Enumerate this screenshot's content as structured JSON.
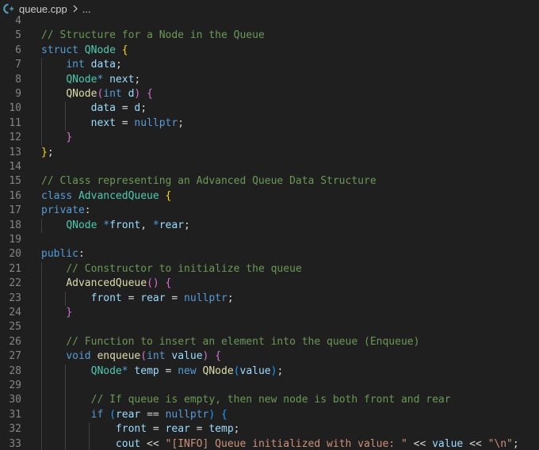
{
  "breadcrumb": {
    "file_icon": "cpp-file-icon",
    "file_name": "queue.cpp",
    "separator_icon": "chevron-right-icon",
    "ellipsis": "..."
  },
  "colors": {
    "background": "#1f1f1f",
    "line_number": "#858585",
    "comment": "#6a9955",
    "keyword": "#569cd6",
    "type": "#4ec9b0",
    "function": "#dcdcaa",
    "variable": "#9cdcfe",
    "string": "#ce9178",
    "brace_level1": "#ffd700",
    "brace_level2": "#da70d6"
  },
  "editor": {
    "lines": [
      {
        "n": "4",
        "tokens": []
      },
      {
        "n": "5",
        "tokens": [
          [
            "comment",
            "// Structure for a Node in the Queue"
          ]
        ]
      },
      {
        "n": "6",
        "tokens": [
          [
            "keyword",
            "struct"
          ],
          [
            "plain",
            " "
          ],
          [
            "type",
            "QNode"
          ],
          [
            "plain",
            " "
          ],
          [
            "brace1",
            "{"
          ]
        ]
      },
      {
        "n": "7",
        "tokens": [
          [
            "plain",
            "    "
          ],
          [
            "keyword",
            "int"
          ],
          [
            "plain",
            " "
          ],
          [
            "var",
            "data"
          ],
          [
            "plain",
            ";"
          ]
        ]
      },
      {
        "n": "8",
        "tokens": [
          [
            "plain",
            "    "
          ],
          [
            "type",
            "QNode"
          ],
          [
            "keyword",
            "*"
          ],
          [
            "plain",
            " "
          ],
          [
            "var",
            "next"
          ],
          [
            "plain",
            ";"
          ]
        ]
      },
      {
        "n": "9",
        "tokens": [
          [
            "plain",
            "    "
          ],
          [
            "func",
            "QNode"
          ],
          [
            "brace2",
            "("
          ],
          [
            "keyword",
            "int"
          ],
          [
            "plain",
            " "
          ],
          [
            "var",
            "d"
          ],
          [
            "brace2",
            ")"
          ],
          [
            "plain",
            " "
          ],
          [
            "brace2",
            "{"
          ]
        ]
      },
      {
        "n": "10",
        "tokens": [
          [
            "plain",
            "        "
          ],
          [
            "var",
            "data"
          ],
          [
            "plain",
            " = "
          ],
          [
            "var",
            "d"
          ],
          [
            "plain",
            ";"
          ]
        ]
      },
      {
        "n": "11",
        "tokens": [
          [
            "plain",
            "        "
          ],
          [
            "var",
            "next"
          ],
          [
            "plain",
            " = "
          ],
          [
            "const",
            "nullptr"
          ],
          [
            "plain",
            ";"
          ]
        ]
      },
      {
        "n": "12",
        "tokens": [
          [
            "plain",
            "    "
          ],
          [
            "brace2",
            "}"
          ]
        ]
      },
      {
        "n": "13",
        "tokens": [
          [
            "brace1",
            "}"
          ],
          [
            "plain",
            ";"
          ]
        ]
      },
      {
        "n": "14",
        "tokens": []
      },
      {
        "n": "15",
        "tokens": [
          [
            "comment",
            "// Class representing an Advanced Queue Data Structure"
          ]
        ]
      },
      {
        "n": "16",
        "tokens": [
          [
            "keyword",
            "class"
          ],
          [
            "plain",
            " "
          ],
          [
            "type",
            "AdvancedQueue"
          ],
          [
            "plain",
            " "
          ],
          [
            "brace1",
            "{"
          ]
        ]
      },
      {
        "n": "17",
        "tokens": [
          [
            "keyword",
            "private"
          ],
          [
            "plain",
            ":"
          ]
        ]
      },
      {
        "n": "18",
        "tokens": [
          [
            "plain",
            "    "
          ],
          [
            "type",
            "QNode"
          ],
          [
            "plain",
            " "
          ],
          [
            "keyword",
            "*"
          ],
          [
            "var",
            "front"
          ],
          [
            "plain",
            ", "
          ],
          [
            "keyword",
            "*"
          ],
          [
            "var",
            "rear"
          ],
          [
            "plain",
            ";"
          ]
        ]
      },
      {
        "n": "19",
        "tokens": []
      },
      {
        "n": "20",
        "tokens": [
          [
            "keyword",
            "public"
          ],
          [
            "plain",
            ":"
          ]
        ]
      },
      {
        "n": "21",
        "tokens": [
          [
            "plain",
            "    "
          ],
          [
            "comment",
            "// Constructor to initialize the queue"
          ]
        ]
      },
      {
        "n": "22",
        "tokens": [
          [
            "plain",
            "    "
          ],
          [
            "func",
            "AdvancedQueue"
          ],
          [
            "brace2",
            "()"
          ],
          [
            "plain",
            " "
          ],
          [
            "brace2",
            "{"
          ]
        ]
      },
      {
        "n": "23",
        "tokens": [
          [
            "plain",
            "        "
          ],
          [
            "var",
            "front"
          ],
          [
            "plain",
            " = "
          ],
          [
            "var",
            "rear"
          ],
          [
            "plain",
            " = "
          ],
          [
            "const",
            "nullptr"
          ],
          [
            "plain",
            ";"
          ]
        ]
      },
      {
        "n": "24",
        "tokens": [
          [
            "plain",
            "    "
          ],
          [
            "brace2",
            "}"
          ]
        ]
      },
      {
        "n": "25",
        "tokens": []
      },
      {
        "n": "26",
        "tokens": [
          [
            "plain",
            "    "
          ],
          [
            "comment",
            "// Function to insert an element into the queue (Enqueue)"
          ]
        ]
      },
      {
        "n": "27",
        "tokens": [
          [
            "plain",
            "    "
          ],
          [
            "keyword",
            "void"
          ],
          [
            "plain",
            " "
          ],
          [
            "func",
            "enqueue"
          ],
          [
            "brace2",
            "("
          ],
          [
            "keyword",
            "int"
          ],
          [
            "plain",
            " "
          ],
          [
            "var",
            "value"
          ],
          [
            "brace2",
            ")"
          ],
          [
            "plain",
            " "
          ],
          [
            "brace2",
            "{"
          ]
        ]
      },
      {
        "n": "28",
        "tokens": [
          [
            "plain",
            "        "
          ],
          [
            "type",
            "QNode"
          ],
          [
            "keyword",
            "*"
          ],
          [
            "plain",
            " "
          ],
          [
            "var",
            "temp"
          ],
          [
            "plain",
            " = "
          ],
          [
            "keyword",
            "new"
          ],
          [
            "plain",
            " "
          ],
          [
            "func",
            "QNode"
          ],
          [
            "brace3",
            "("
          ],
          [
            "var",
            "value"
          ],
          [
            "brace3",
            ")"
          ],
          [
            "plain",
            ";"
          ]
        ]
      },
      {
        "n": "29",
        "tokens": []
      },
      {
        "n": "30",
        "tokens": [
          [
            "plain",
            "        "
          ],
          [
            "comment",
            "// If queue is empty, then new node is both front and rear"
          ]
        ]
      },
      {
        "n": "31",
        "tokens": [
          [
            "plain",
            "        "
          ],
          [
            "control",
            "if"
          ],
          [
            "plain",
            " "
          ],
          [
            "brace3",
            "("
          ],
          [
            "var",
            "rear"
          ],
          [
            "plain",
            " == "
          ],
          [
            "const",
            "nullptr"
          ],
          [
            "brace3",
            ")"
          ],
          [
            "plain",
            " "
          ],
          [
            "brace3",
            "{"
          ]
        ]
      },
      {
        "n": "32",
        "tokens": [
          [
            "plain",
            "            "
          ],
          [
            "var",
            "front"
          ],
          [
            "plain",
            " = "
          ],
          [
            "var",
            "rear"
          ],
          [
            "plain",
            " = "
          ],
          [
            "var",
            "temp"
          ],
          [
            "plain",
            ";"
          ]
        ]
      },
      {
        "n": "33",
        "tokens": [
          [
            "plain",
            "            "
          ],
          [
            "var",
            "cout"
          ],
          [
            "plain",
            " << "
          ],
          [
            "string",
            "\"[INFO] Queue initialized with value: \""
          ],
          [
            "plain",
            " << "
          ],
          [
            "var",
            "value"
          ],
          [
            "plain",
            " << "
          ],
          [
            "string",
            "\"\\n\""
          ],
          [
            "plain",
            ";"
          ]
        ]
      }
    ]
  }
}
